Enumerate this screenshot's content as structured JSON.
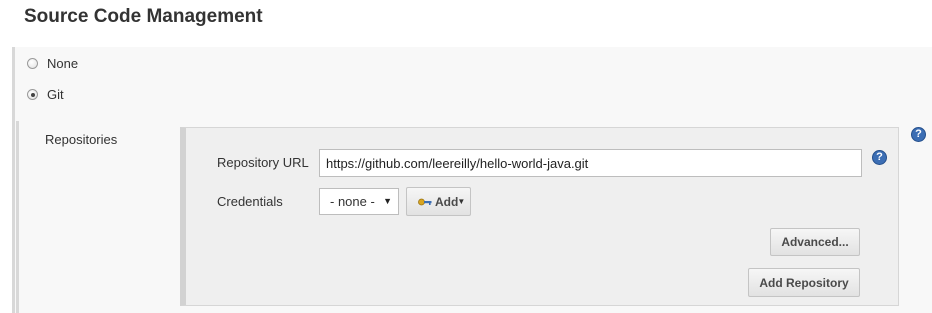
{
  "section": {
    "title": "Source Code Management"
  },
  "scm_options": [
    {
      "label": "None",
      "selected": false
    },
    {
      "label": "Git",
      "selected": true
    }
  ],
  "git": {
    "repositories_label": "Repositories",
    "repository_url": {
      "label": "Repository URL",
      "value": "https://github.com/leereilly/hello-world-java.git"
    },
    "credentials": {
      "label": "Credentials",
      "selected": "- none -"
    },
    "add_button_label": "Add",
    "advanced_button_label": "Advanced...",
    "add_repository_button_label": "Add Repository"
  },
  "help_icon_glyph": "?",
  "colors": {
    "help_icon": "#3c6eb4",
    "panel_background": "#efefef",
    "section_background": "#f8f8f8"
  },
  "icons": {
    "credentials_add": "key-icon",
    "help": "help-icon"
  }
}
